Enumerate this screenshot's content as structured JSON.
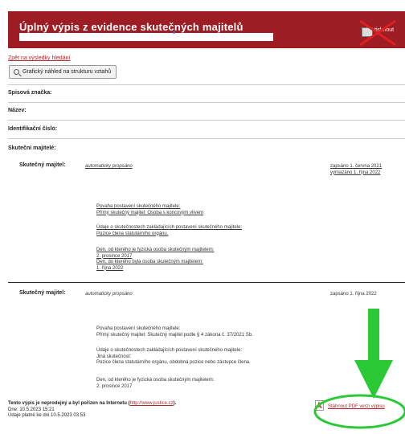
{
  "header": {
    "title": "Úplný výpis z evidence skutečných majitelů",
    "print_label": "tisknout"
  },
  "nav": {
    "back_link": "Zpět na výsledky hledání",
    "graph_button": "Grafický náhled na strukturu vztahů"
  },
  "fields": {
    "spisova": "Spisová značka:",
    "nazev": "Název:",
    "ico": "Identifikační číslo:",
    "majitele": "Skuteční majitelé:"
  },
  "owners": [
    {
      "label": "Skutečný majitel:",
      "name": "automaticky propsáno",
      "dates": [
        "zapsáno 1. června 2021",
        "vymazáno 1. října 2022"
      ],
      "details": [
        "Povaha postavení skutečného majitele:",
        "Přímý skutečný majitel: Osoba s koncovým vlivem",
        "Údaje o skutečnostech zakládajících postavení skutečného majitele:",
        "Pozice člena statutárního orgánu.",
        "Den, od kterého je fyzická osoba skutečným majitelem:",
        "2. prosince 2017",
        "Den, do kterého byla osoba skutečným majitelem:",
        "1. října 2022"
      ]
    },
    {
      "label": "Skutečný majitel:",
      "name": "automaticky propsáno",
      "dates": [
        "zapsáno 1. října 2022"
      ],
      "details": [
        "Povaha postavení skutečného majitele:",
        "Přímý skutečný majitel: Skutečný majitel podle § 4 zákona č. 37/2021 Sb.",
        "Údaje o skutečnostech zakládajících postavení skutečného majitele:",
        "Jiná skutečnost:",
        "Pozice člena statutárního orgánu, obdobná pozice nebo zástupce člena.",
        "Den, od kterého je fyzická osoba skutečným majitelem:",
        "2. prosince 2017"
      ]
    }
  ],
  "footer": {
    "note_start": "Tento výpis je neprodejný a byl pořízen na Internetu (",
    "note_link": "http://www.justice.cz",
    "note_end": ").",
    "date_line": "Dne: 10.5.2023 15:21",
    "valid_line": "Údaje platné ke dni 10.5.2023 03:53"
  },
  "pdf": {
    "label": "Stáhnout PDF verzi výpisu"
  },
  "colors": {
    "header_bg": "#9e1c23",
    "link": "#b0282e",
    "annotation_arrow": "#2bc936",
    "annotation_circle": "#2bc936",
    "annotation_x": "#d92121"
  }
}
